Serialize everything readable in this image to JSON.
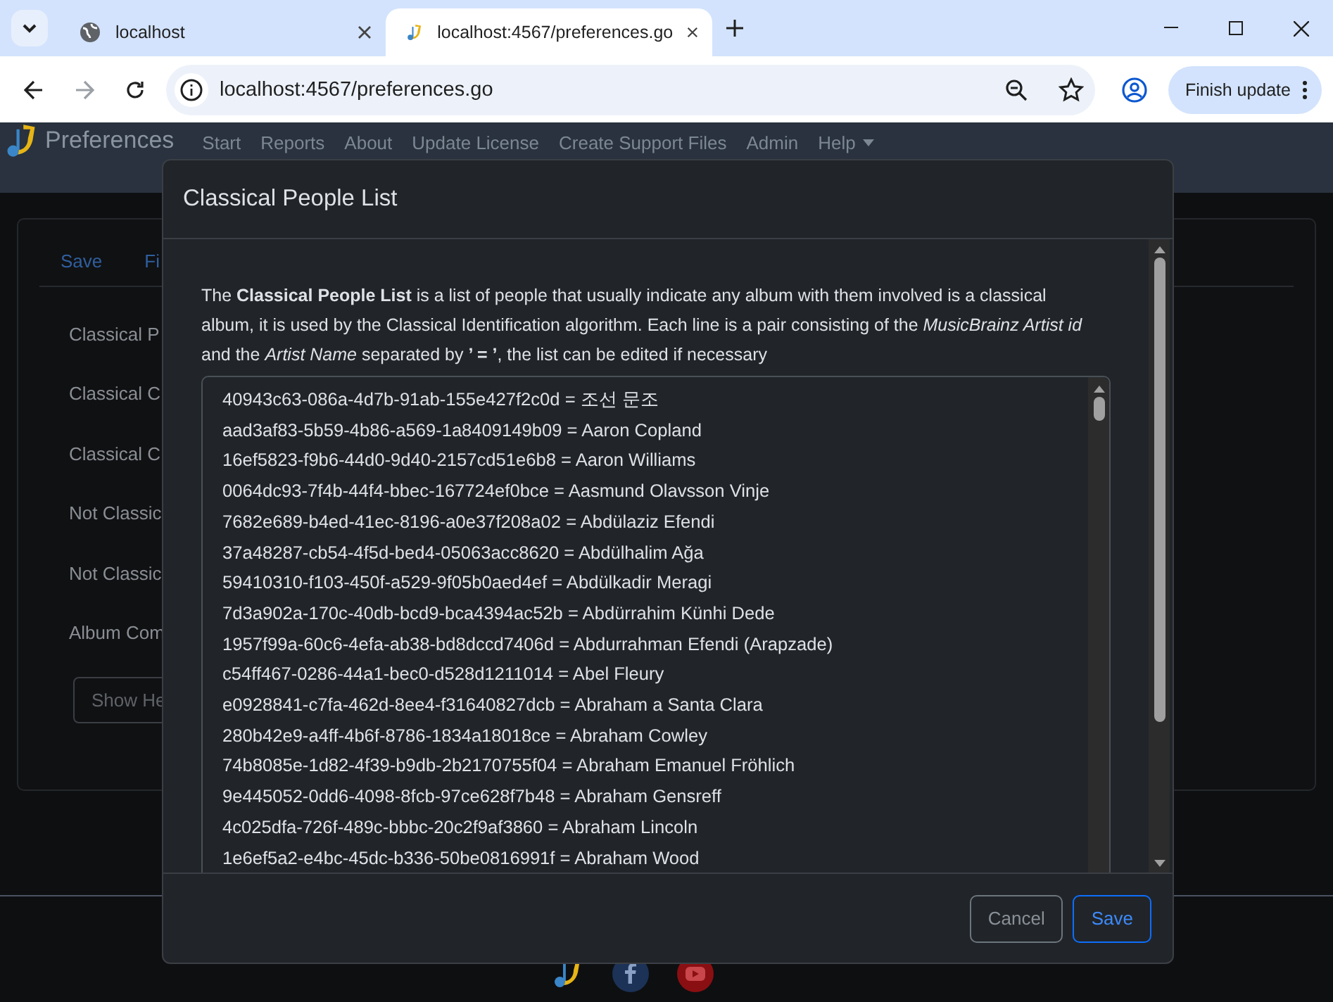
{
  "browser": {
    "tabs": [
      {
        "title": "localhost",
        "selected": false
      },
      {
        "title": "localhost:4567/preferences.go",
        "selected": true
      }
    ],
    "address": "localhost:4567/preferences.go",
    "update_button": "Finish update"
  },
  "app": {
    "brand": "Preferences",
    "nav": [
      {
        "label": "Start"
      },
      {
        "label": "Reports"
      },
      {
        "label": "About"
      },
      {
        "label": "Update License"
      },
      {
        "label": "Create Support Files"
      },
      {
        "label": "Admin"
      },
      {
        "label": "Help",
        "dropdown": true
      }
    ]
  },
  "page": {
    "tabs": [
      "Save",
      "Fi"
    ],
    "fields": [
      "Classical P",
      "Classical C",
      "Classical C",
      "Not Classic",
      "Not Classic",
      "Album Com"
    ],
    "button": "Show He"
  },
  "modal": {
    "title": "Classical People List",
    "description": "The **Classical People List** is a list of people that usually indicate any album with them involved is a classical album, it is used by the Classical Identification algorithm. Each line is a pair consisting of the *MusicBrainz Artist id* and the *Artist Name* separated by **’ = ’**, the list can be edited if necessary",
    "lines": [
      "40943c63-086a-4d7b-91ab-155e427f2c0d = 조선 문조",
      "aad3af83-5b59-4b86-a569-1a8409149b09 = Aaron Copland",
      "16ef5823-f9b6-44d0-9d40-2157cd51e6b8 = Aaron Williams",
      "0064dc93-7f4b-44f4-bbec-167724ef0bce = Aasmund Olavsson Vinje",
      "7682e689-b4ed-41ec-8196-a0e37f208a02 = Abdülaziz Efendi",
      "37a48287-cb54-4f5d-bed4-05063acc8620 = Abdülhalim Ağa",
      "59410310-f103-450f-a529-9f05b0aed4ef = Abdülkadir Meragi",
      "7d3a902a-170c-40db-bcd9-bca4394ac52b = Abdürrahim Künhi Dede",
      "1957f99a-60c6-4efa-ab38-bd8dccd7406d = Abdurrahman Efendi (Arapzade)",
      "c54ff467-0286-44a1-bec0-d528d1211014 = Abel Fleury",
      "e0928841-c7fa-462d-8ee4-f31640827dcb = Abraham a Santa Clara",
      "280b42e9-a4ff-4b6f-8786-1834a18018ce = Abraham Cowley",
      "74b8085e-1d82-4f39-b9db-2b2170755f04 = Abraham Emanuel Fröhlich",
      "9e445052-0dd6-4098-8fcb-97ce628f7b48 = Abraham Gensreff",
      "4c025dfa-726f-489c-bbbc-20c2f9af3860 = Abraham Lincoln",
      "1e6ef5a2-e4bc-45dc-b336-50be0816991f = Abraham Wood"
    ],
    "buttons": [
      {
        "label": "Cancel",
        "kind": "secondary"
      },
      {
        "label": "Save",
        "kind": "primary"
      }
    ]
  }
}
